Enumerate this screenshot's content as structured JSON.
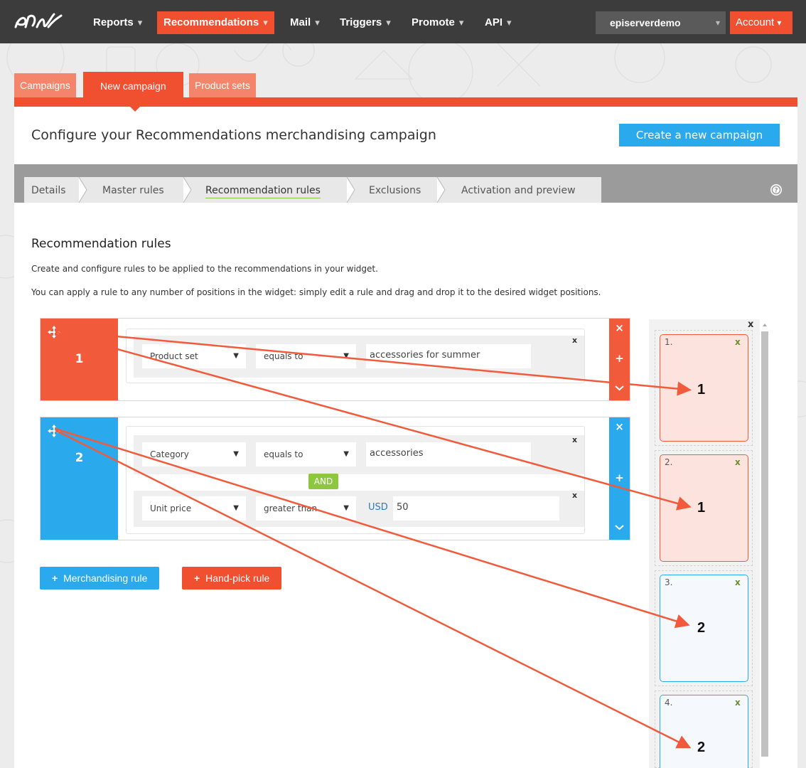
{
  "colors": {
    "accent": "#f04f30",
    "blue": "#2aa9ec",
    "green": "#8dc63f",
    "topbar": "#3c3c3c"
  },
  "topnav": {
    "items": [
      {
        "label": "Reports",
        "caret": "▾"
      },
      {
        "label": "Recommendations",
        "caret": "▾"
      },
      {
        "label": "Mail",
        "caret": "▾"
      },
      {
        "label": "Triggers",
        "caret": "▾"
      },
      {
        "label": "Promote",
        "caret": "▾"
      },
      {
        "label": "API",
        "caret": "▾"
      }
    ],
    "site": "episerverdemo",
    "account": "Account"
  },
  "tabs": [
    "Campaigns",
    "New campaign",
    "Product sets"
  ],
  "page_title": "Configure your Recommendations merchandising campaign",
  "create_button": "Create a new campaign",
  "steps": [
    "Details",
    "Master rules",
    "Recommendation rules",
    "Exclusions",
    "Activation and preview"
  ],
  "section": {
    "title": "Recommendation rules",
    "desc1": "Create and configure rules to be applied to the recommendations in your widget.",
    "desc2": "You can apply a rule to any number of positions in the widget: simply edit a rule and drag and drop it to the desired widget positions."
  },
  "rules": [
    {
      "number": "1",
      "conditions": [
        {
          "field": "Product set",
          "operator": "equals to",
          "value": "accessories for summer"
        }
      ]
    },
    {
      "number": "2",
      "conditions": [
        {
          "field": "Category",
          "operator": "equals to",
          "value": "accessories"
        },
        {
          "field": "Unit price",
          "operator": "greater than",
          "currency": "USD",
          "value": "50"
        }
      ],
      "joiner": "AND"
    }
  ],
  "buttons": {
    "merch": "Merchandising rule",
    "handpick": "Hand-pick rule"
  },
  "slots": [
    {
      "label": "1.",
      "rule": "1"
    },
    {
      "label": "2.",
      "rule": "1"
    },
    {
      "label": "3.",
      "rule": "2"
    },
    {
      "label": "4.",
      "rule": "2"
    }
  ],
  "glyphs": {
    "close": "×",
    "small_x": "x",
    "plus": "+",
    "dropdown": "▼"
  }
}
